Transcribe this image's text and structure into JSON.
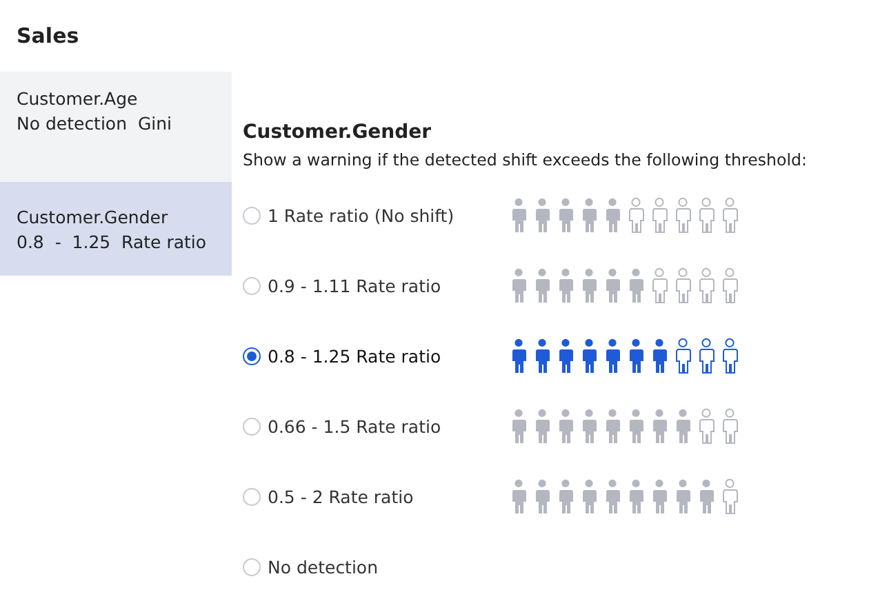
{
  "header": {
    "title": "Sales"
  },
  "sidebar": {
    "items": [
      {
        "name": "Customer.Age",
        "detail": "No detection  Gini",
        "selected": false
      },
      {
        "name": "Customer.Gender",
        "detail": "0.8  -  1.25  Rate ratio",
        "selected": true
      }
    ]
  },
  "panel": {
    "title": "Customer.Gender",
    "instruction": "Show a warning if the detected shift exceeds the following threshold:",
    "options": [
      {
        "label": "1 Rate ratio (No shift)",
        "selected": false,
        "people": [
          {
            "filled": true
          },
          {
            "filled": true
          },
          {
            "filled": true
          },
          {
            "filled": true
          },
          {
            "filled": true
          },
          {
            "filled": false
          },
          {
            "filled": false
          },
          {
            "filled": false
          },
          {
            "filled": false
          },
          {
            "filled": false
          }
        ]
      },
      {
        "label": "0.9 - 1.11 Rate ratio",
        "selected": false,
        "people": [
          {
            "filled": true
          },
          {
            "filled": true
          },
          {
            "filled": true
          },
          {
            "filled": true
          },
          {
            "filled": true
          },
          {
            "filled": true
          },
          {
            "filled": false
          },
          {
            "filled": false
          },
          {
            "filled": false
          },
          {
            "filled": false
          }
        ]
      },
      {
        "label": "0.8 - 1.25 Rate ratio",
        "selected": true,
        "people": [
          {
            "filled": true
          },
          {
            "filled": true
          },
          {
            "filled": true
          },
          {
            "filled": true
          },
          {
            "filled": true
          },
          {
            "filled": true
          },
          {
            "filled": true
          },
          {
            "filled": false
          },
          {
            "filled": false
          },
          {
            "filled": false
          }
        ]
      },
      {
        "label": "0.66 - 1.5 Rate ratio",
        "selected": false,
        "people": [
          {
            "filled": true
          },
          {
            "filled": true
          },
          {
            "filled": true
          },
          {
            "filled": true
          },
          {
            "filled": true
          },
          {
            "filled": true
          },
          {
            "filled": true
          },
          {
            "filled": true
          },
          {
            "filled": false
          },
          {
            "filled": false
          }
        ]
      },
      {
        "label": "0.5 - 2 Rate ratio",
        "selected": false,
        "people": [
          {
            "filled": true
          },
          {
            "filled": true
          },
          {
            "filled": true
          },
          {
            "filled": true
          },
          {
            "filled": true
          },
          {
            "filled": true
          },
          {
            "filled": true
          },
          {
            "filled": true
          },
          {
            "filled": true
          },
          {
            "filled": false
          }
        ]
      },
      {
        "label": "No detection",
        "selected": false
      }
    ]
  }
}
